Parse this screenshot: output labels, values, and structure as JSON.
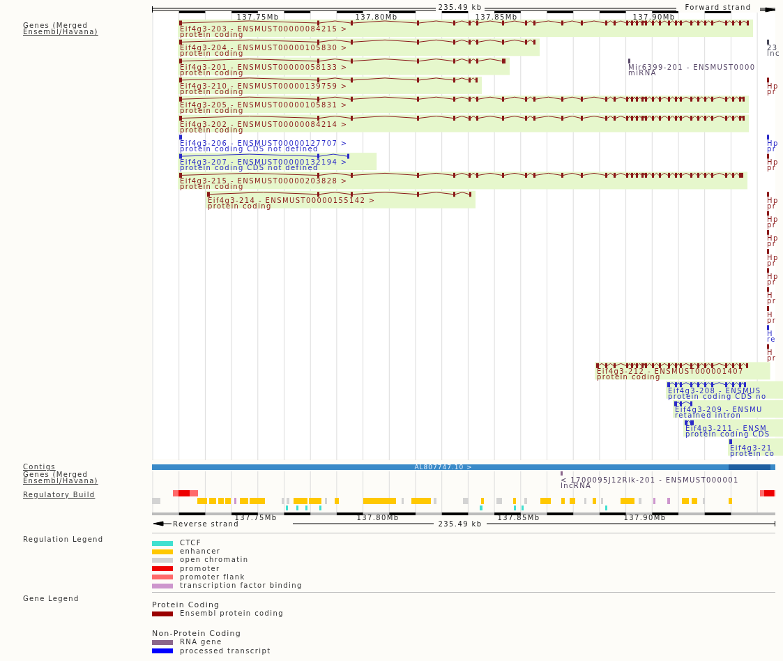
{
  "genes_track": {
    "label": [
      "Genes (Merged",
      "Ensembl/Havana)"
    ],
    "scale": {
      "length": "235.49 kb",
      "strand": "Forward strand",
      "ticks": [
        "137.75Mb",
        "137.80Mb",
        "137.85Mb",
        "137.90Mb"
      ]
    },
    "transcripts": [
      {
        "name": "Eif4g3-203 - ENSMUST00000084215 >",
        "biotype": "protein coding",
        "color": "#8b1a1a",
        "highlighted": true
      },
      {
        "name": "Eif4g3-204 - ENSMUST00000105830 >",
        "biotype": "protein coding",
        "color": "#8b1a1a",
        "highlighted": true
      },
      {
        "name": "Eif4g3-201 - ENSMUST00000058133 >",
        "biotype": "protein coding",
        "color": "#8b1a1a",
        "highlighted": true
      },
      {
        "name": "Eif4g3-210 - ENSMUST00000139759 >",
        "biotype": "protein coding",
        "color": "#8b1a1a",
        "highlighted": true
      },
      {
        "name": "Eif4g3-205 - ENSMUST00000105831 >",
        "biotype": "protein coding",
        "color": "#8b1a1a",
        "highlighted": true
      },
      {
        "name": "Eif4g3-202 - ENSMUST00000084214 >",
        "biotype": "protein coding",
        "color": "#8b1a1a",
        "highlighted": true
      },
      {
        "name": "Eif4g3-206 - ENSMUST00000127707 >",
        "biotype": "protein coding CDS not defined",
        "color": "#2b2bc8",
        "highlighted": false
      },
      {
        "name": "Eif4g3-207 - ENSMUST00000132194 >",
        "biotype": "protein coding CDS not defined",
        "color": "#2b2bc8",
        "highlighted": true
      },
      {
        "name": "Eif4g3-215 - ENSMUST00000203828 >",
        "biotype": "protein coding",
        "color": "#8b1a1a",
        "highlighted": true
      },
      {
        "name": "Eif4g3-214 - ENSMUST00000155142 >",
        "biotype": "protein coding",
        "color": "#8b1a1a",
        "highlighted": true
      },
      {
        "name": "Eif4g3-212 - ENSMUST000001407",
        "biotype": "protein coding",
        "color": "#8b1a1a",
        "highlighted": true
      },
      {
        "name": "Eif4g3-208 - ENSMUS",
        "biotype": "protein coding CDS no",
        "color": "#2b2bc8",
        "highlighted": true
      },
      {
        "name": "Eif4g3-209 - ENSMU",
        "biotype": "retained intron",
        "color": "#2b2bc8",
        "highlighted": true
      },
      {
        "name": "Eif4g3-211 - ENSM",
        "biotype": "protein coding CDS",
        "color": "#2b2bc8",
        "highlighted": true
      },
      {
        "name": "Eif4g3-21",
        "biotype": "protein co",
        "color": "#2b2bc8",
        "highlighted": true
      }
    ],
    "other_genes": [
      {
        "name": "23",
        "biotype": "lnc",
        "color": "#4a4a5a"
      },
      {
        "name": "Mir6399-201 - ENSMUST0000",
        "biotype": "miRNA",
        "color": "#5a4a6a"
      },
      {
        "name": "Hp",
        "biotype": "pr",
        "color": "#8b1a1a"
      },
      {
        "name": "Hp",
        "biotype": "pr",
        "color": "#2b2bc8"
      },
      {
        "name": "Hp",
        "biotype": "pr",
        "color": "#8b1a1a"
      },
      {
        "name": "Hp",
        "biotype": "pr",
        "color": "#8b1a1a"
      },
      {
        "name": "Hp",
        "biotype": "pr",
        "color": "#8b1a1a"
      },
      {
        "name": "Hp",
        "biotype": "pr",
        "color": "#8b1a1a"
      },
      {
        "name": "Hp",
        "biotype": "pr",
        "color": "#8b1a1a"
      },
      {
        "name": "Hp",
        "biotype": "pr",
        "color": "#8b1a1a"
      },
      {
        "name": "H",
        "biotype": "pr",
        "color": "#8b1a1a"
      },
      {
        "name": "H",
        "biotype": "pr",
        "color": "#8b1a1a"
      },
      {
        "name": "H",
        "biotype": "re",
        "color": "#2b2bc8"
      },
      {
        "name": "H",
        "biotype": "pr",
        "color": "#8b1a1a"
      }
    ]
  },
  "contigs": {
    "label": "Contigs",
    "contig": "AL807747.10 >"
  },
  "lower_genes": {
    "label": [
      "Genes (Merged",
      "Ensembl/Havana)"
    ],
    "name": "< 1700095J12Rik-201 - ENSMUST000001",
    "biotype": "lncRNA"
  },
  "regulatory_build": {
    "label": "Regulatory Build"
  },
  "bottom_scale": {
    "ticks": [
      "137.75Mb",
      "137.80Mb",
      "137.85Mb",
      "137.90Mb"
    ],
    "strand": "Reverse strand",
    "length": "235.49 kb"
  },
  "regulation_legend": {
    "title": "Regulation Legend",
    "items": [
      {
        "label": "CTCF",
        "color": "#40e0d0"
      },
      {
        "label": "enhancer",
        "color": "#ffc800"
      },
      {
        "label": "open chromatin",
        "color": "#d3d3d3"
      },
      {
        "label": "promoter",
        "color": "#ee0000"
      },
      {
        "label": "promoter flank",
        "color": "#ff6a6a"
      },
      {
        "label": "transcription factor binding",
        "color": "#cd96cd"
      }
    ]
  },
  "gene_legend": {
    "title": "Gene Legend",
    "groups": [
      {
        "title": "Protein Coding",
        "items": [
          {
            "label": "Ensembl protein coding",
            "color": "#9a0000"
          }
        ]
      },
      {
        "title": "Non-Protein Coding",
        "items": [
          {
            "label": "RNA gene",
            "color": "#8b668b"
          },
          {
            "label": "processed transcript",
            "color": "#0000ff"
          }
        ]
      }
    ]
  }
}
